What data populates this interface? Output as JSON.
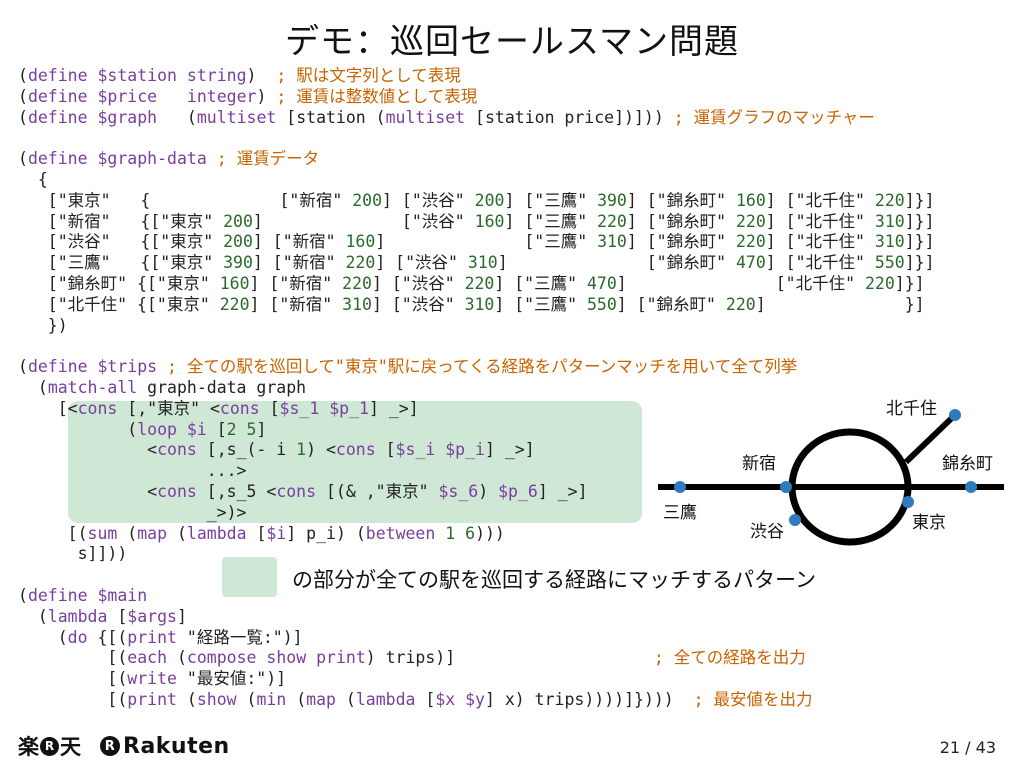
{
  "title": "デモ：巡回セールスマン問題",
  "colors": {
    "highlight": "#cfe7d5",
    "keyword": "#7a3e9d",
    "comment": "#c86400",
    "number": "#2a6a2a",
    "station": "#2f7bbd"
  },
  "code_lines": [
    "(define $station string)  ; 駅は文字列として表現",
    "(define $price   integer) ; 運賃は整数値として表現",
    "(define $graph   (multiset [station (multiset [station price])])) ; 運賃グラフのマッチャー",
    "",
    "(define $graph-data ; 運賃データ",
    "  {",
    "   [\"東京\"   {             [\"新宿\" 200] [\"渋谷\" 200] [\"三鷹\" 390] [\"錦糸町\" 160] [\"北千住\" 220]}]",
    "   [\"新宿\"   {[\"東京\" 200]              [\"渋谷\" 160] [\"三鷹\" 220] [\"錦糸町\" 220] [\"北千住\" 310]}]",
    "   [\"渋谷\"   {[\"東京\" 200] [\"新宿\" 160]              [\"三鷹\" 310] [\"錦糸町\" 220] [\"北千住\" 310]}]",
    "   [\"三鷹\"   {[\"東京\" 390] [\"新宿\" 220] [\"渋谷\" 310]              [\"錦糸町\" 470] [\"北千住\" 550]}]",
    "   [\"錦糸町\" {[\"東京\" 160] [\"新宿\" 220] [\"渋谷\" 220] [\"三鷹\" 470]               [\"北千住\" 220]}]",
    "   [\"北千住\" {[\"東京\" 220] [\"新宿\" 310] [\"渋谷\" 310] [\"三鷹\" 550] [\"錦糸町\" 220]              }]",
    "   })",
    "",
    "(define $trips ; 全ての駅を巡回して\"東京\"駅に戻ってくる経路をパターンマッチを用いて全て列挙",
    "  (match-all graph-data graph",
    "    [<cons [,\"東京\" <cons [$s_1 $p_1] _>]",
    "           (loop $i [2 5]",
    "             <cons [,s_(- i 1) <cons [$s_i $p_i] _>]",
    "                   ...>",
    "             <cons [,s_5 <cons [(& ,\"東京\" $s_6) $p_6] _>]",
    "                   _>)>",
    "     [(sum (map (lambda [$i] p_i) (between 1 6)))",
    "      s]]))",
    "",
    "(define $main",
    "  (lambda [$args]",
    "    (do {[(print \"経路一覧:\")]",
    "         [(each (compose show print) trips)]                    ; 全ての経路を出力",
    "         [(write \"最安値:\")]",
    "         [(print (show (min (map (lambda [$x $y] x) trips))))]})))  ; 最安値を出力"
  ],
  "legend_text": "の部分が全ての駅を巡回する経路にマッチするパターン",
  "map": {
    "stations": [
      "北千住",
      "新宿",
      "錦糸町",
      "三鷹",
      "渋谷",
      "東京"
    ]
  },
  "footer": {
    "logo_kanji_1": "楽",
    "logo_r": "R",
    "logo_kanji_2": "天",
    "logo_word": "Rakuten",
    "page_number": "21 / 43"
  }
}
